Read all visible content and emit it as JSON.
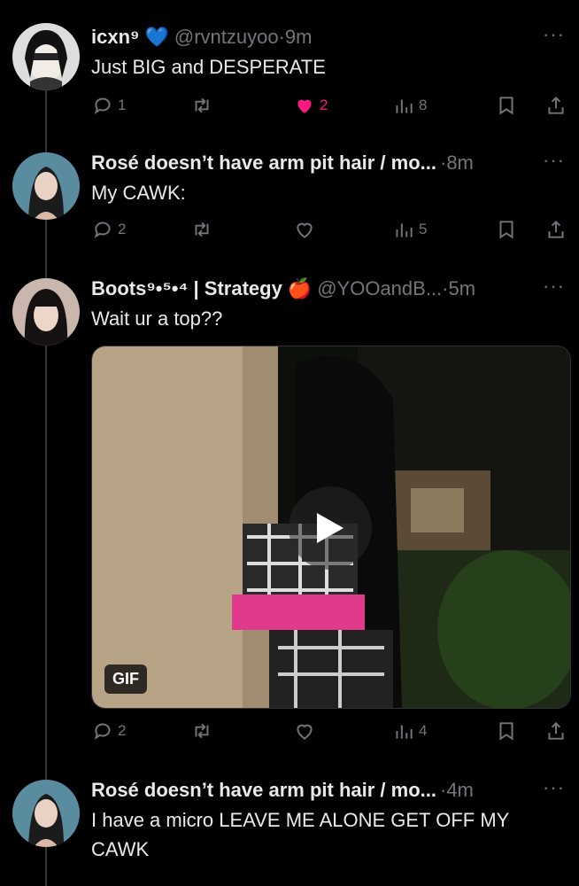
{
  "tweets": [
    {
      "name": "icxn⁹",
      "name_badge": "💙",
      "handle": "@rvntzuyoo",
      "dot": "·",
      "time": "9m",
      "text": "Just BIG and DESPERATE",
      "more": "···",
      "counts": {
        "reply": "1",
        "retweet": "",
        "like": "2",
        "views": "8"
      },
      "liked": true
    },
    {
      "name": "Rosé doesn’t have arm pit hair / mo...",
      "handle": "",
      "dot": "·",
      "time": "8m",
      "text": "My CAWK:",
      "more": "···",
      "counts": {
        "reply": "2",
        "retweet": "",
        "like": "",
        "views": "5"
      },
      "liked": false
    },
    {
      "name": "Boots⁹•⁵•⁴ | Strategy",
      "name_badge": "🍎",
      "handle": "@YOOandB...",
      "dot": "·",
      "time": "5m",
      "text": "Wait ur a top??",
      "more": "···",
      "media": {
        "badge": "GIF",
        "type": "gif"
      },
      "counts": {
        "reply": "2",
        "retweet": "",
        "like": "",
        "views": "4"
      },
      "liked": false
    },
    {
      "name": "Rosé doesn’t have arm pit hair / mo...",
      "handle": "",
      "dot": "·",
      "time": "4m",
      "text": "I have a micro LEAVE ME ALONE GET OFF MY CAWK",
      "more": "···"
    }
  ],
  "colors": {
    "background": "#000000",
    "text": "#e7e9ea",
    "muted": "#71767b",
    "like": "#f91880",
    "thread": "#333639"
  },
  "icons": [
    "reply-icon",
    "retweet-icon",
    "like-icon",
    "views-icon",
    "bookmark-icon",
    "share-icon",
    "play-icon",
    "more-icon"
  ]
}
